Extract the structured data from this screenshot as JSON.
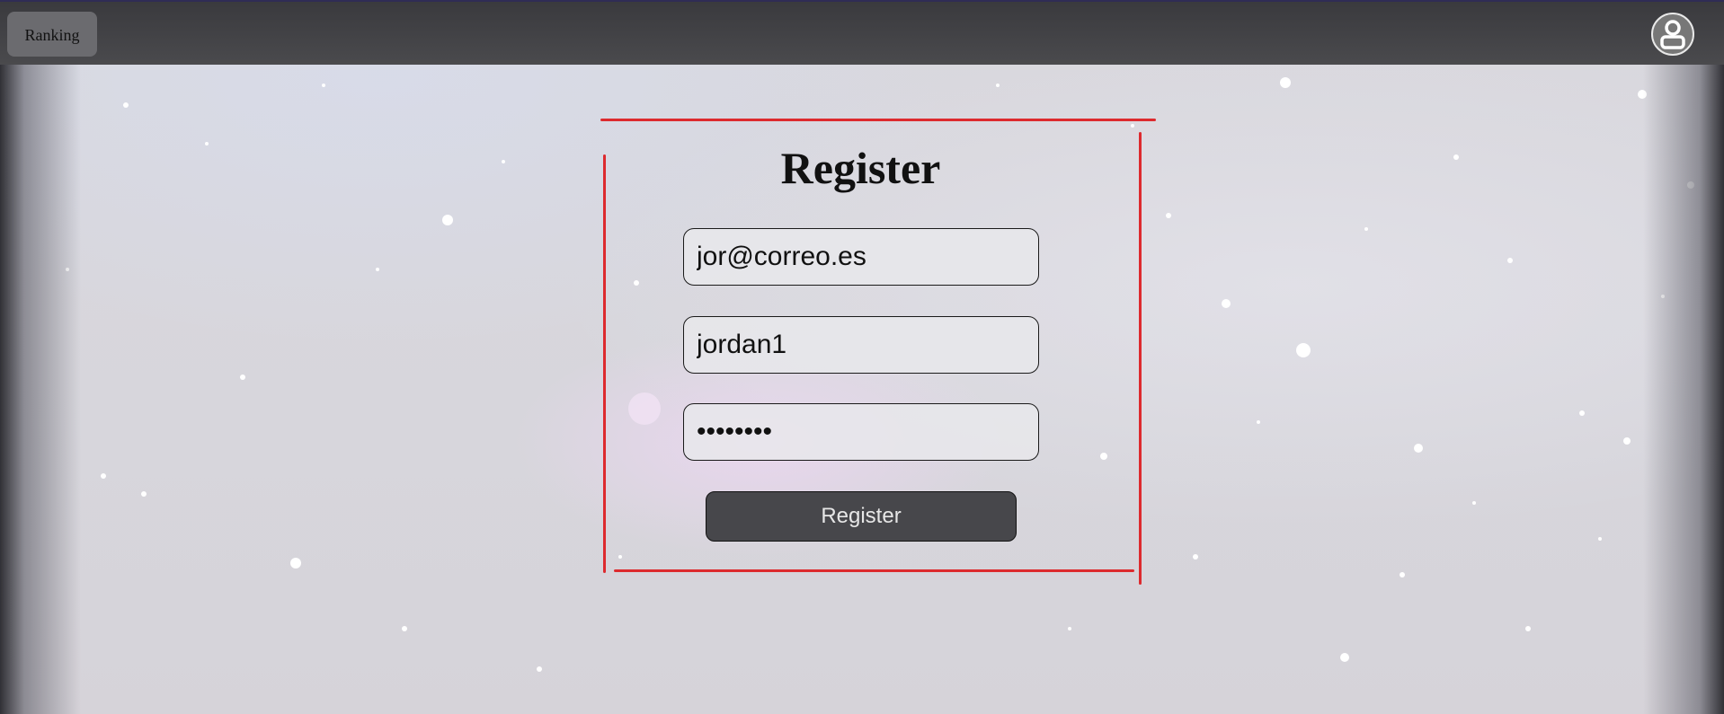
{
  "topbar": {
    "ranking_label": "Ranking",
    "profile_icon": "user-icon"
  },
  "register_form": {
    "title": "Register",
    "email_value": "jor@correo.es",
    "username_value": "jordan1",
    "password_value": "jordan12",
    "submit_label": "Register"
  },
  "colors": {
    "frame_red": "#dd2a2e",
    "topbar": "#444447",
    "button_dark": "#47474b"
  }
}
